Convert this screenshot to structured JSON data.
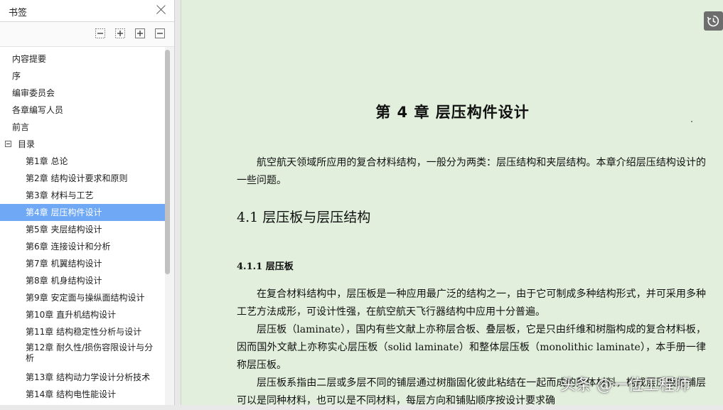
{
  "sidebar": {
    "title": "书签",
    "toolbar": [
      {
        "icon": "collapse-all-icon"
      },
      {
        "icon": "expand-all-icon"
      },
      {
        "icon": "add-bookmark-icon"
      },
      {
        "icon": "delete-bookmark-icon"
      }
    ],
    "items": [
      {
        "label": "内容提要"
      },
      {
        "label": "序"
      },
      {
        "label": "编审委员会"
      },
      {
        "label": "各章编写人员"
      },
      {
        "label": "前言"
      },
      {
        "label": "目录",
        "expanded": true
      },
      {
        "label": "第1章  总论"
      },
      {
        "label": "第2章    结构设计要求和原则"
      },
      {
        "label": "第3章    材料与工艺"
      },
      {
        "label": "第4章    层压构件设计",
        "selected": true
      },
      {
        "label": "第5章    夹层结构设计"
      },
      {
        "label": "第6章    连接设计和分析"
      },
      {
        "label": "第7章    机翼结构设计"
      },
      {
        "label": "第8章    机身结构设计"
      },
      {
        "label": "第9章    安定面与操纵面结构设计"
      },
      {
        "label": "第10章    直升机结构设计"
      },
      {
        "label": "第11章    结构稳定性分析与设计"
      },
      {
        "label": "第12章    耐久性/损伤容限设计与分析"
      },
      {
        "label": "第13章    结构动力学设计分析技术"
      },
      {
        "label": "第14章    结构电性能设计"
      }
    ]
  },
  "document": {
    "chapter_title": "第 4 章    层压构件设计",
    "intro": "航空航天领域所应用的复合材料结构，一般分为两类：层压结构和夹层结构。本章介绍层压结构设计的一些问题。",
    "section_title": "4.1    层压板与层压结构",
    "subsection_title": "4.1.1    层压板",
    "paragraphs": [
      "在复合材料结构中，层压板是一种应用最广泛的结构之一，由于它可制成多种结构形式，并可采用多种工艺方法成形，可设计性强，在航空航天飞行器结构中应用十分普遍。",
      "层压板（laminate），国内有些文献上亦称层合板、叠层板，它是只由纤维和树脂构成的复合材料板，因而国外文献上亦称实心层压板（solid laminate）和整体层压板（monolithic laminate），本手册一律称层压板。",
      "层压板系指由二层或多层不同的铺层通过树脂固化彼此粘结在一起而成的整体材料，构成层压板的铺层可以是同种材料，也可以是不同材料，每层方向和铺贴顺序按设计要求确"
    ]
  },
  "watermark": "头条 @一位工程师",
  "colors": {
    "page_background": "#e2efdc",
    "selection": "#6fa8f4"
  }
}
